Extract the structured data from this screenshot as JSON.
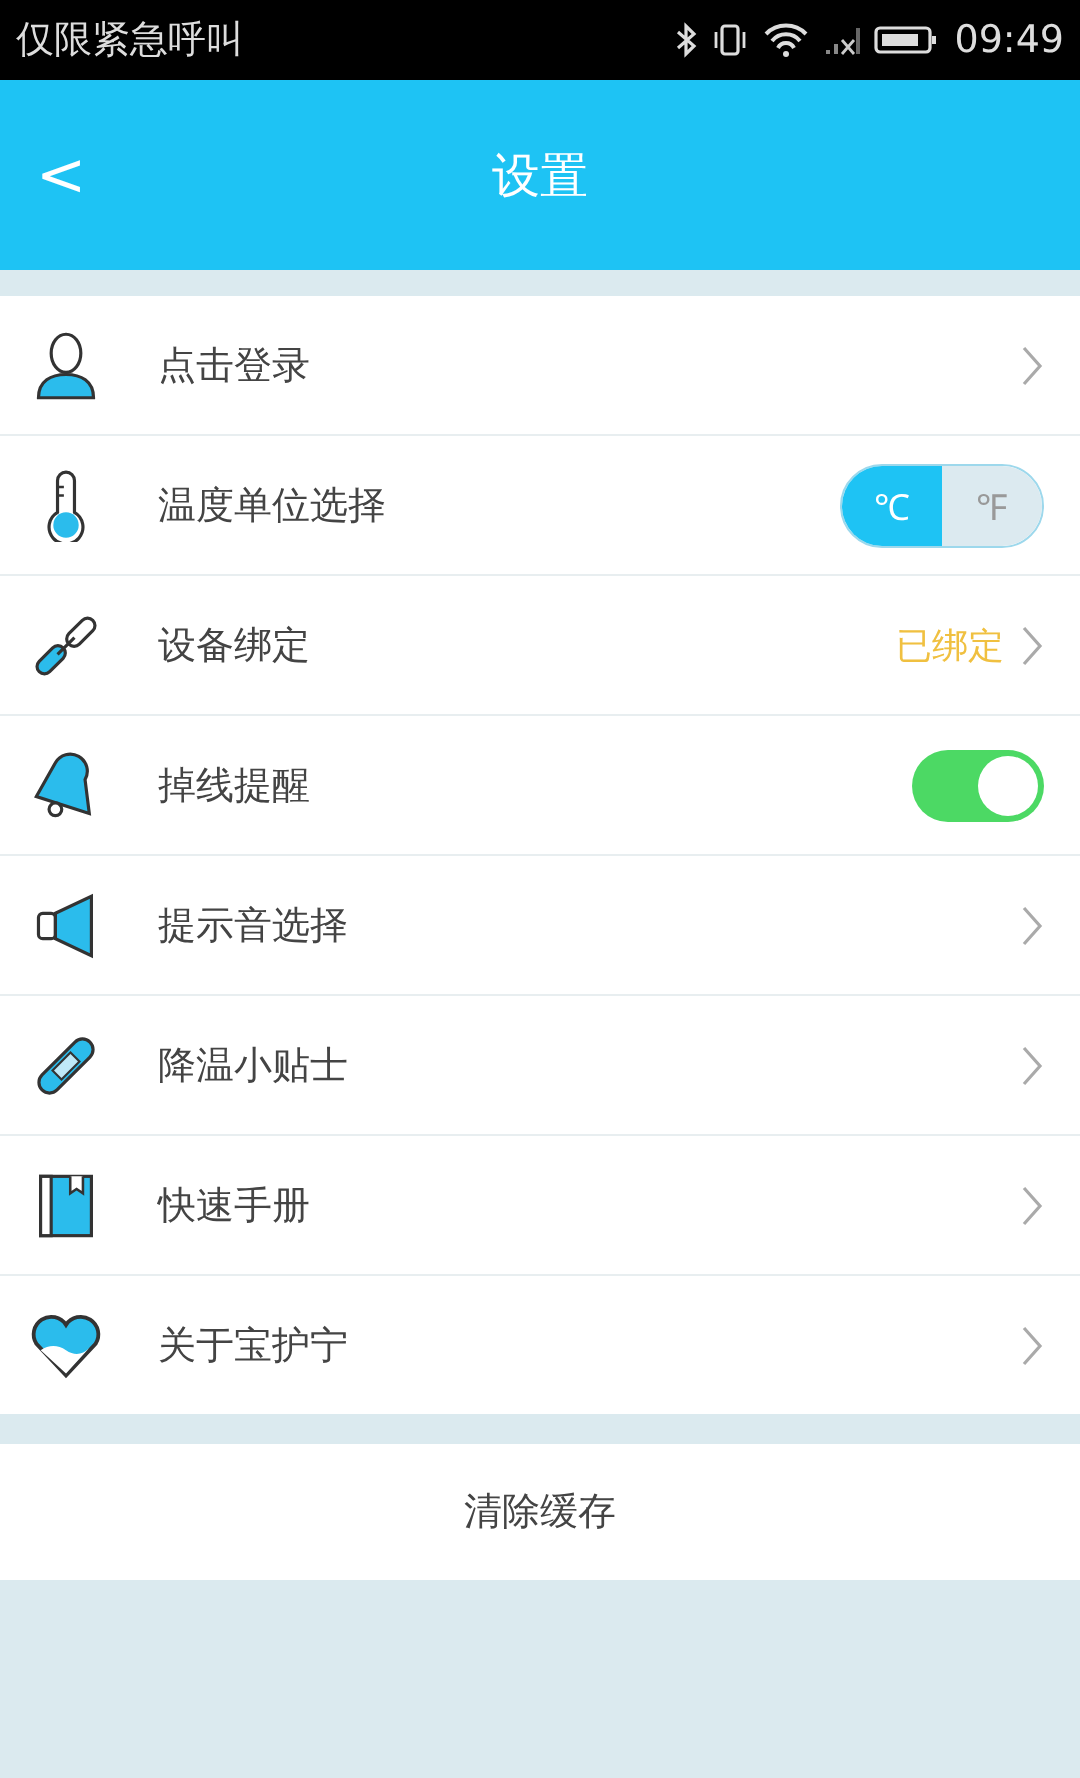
{
  "status_bar": {
    "carrier": "仅限紧急呼叫",
    "time": "09:49"
  },
  "header": {
    "back": "<",
    "title": "设置"
  },
  "items": [
    {
      "kind": "chevron",
      "label": "点击登录"
    },
    {
      "kind": "unit_toggle",
      "label": "温度单位选择",
      "options": [
        {
          "label": "℃",
          "selected": true
        },
        {
          "label": "℉",
          "selected": false
        }
      ]
    },
    {
      "kind": "value_chevron",
      "label": "设备绑定",
      "value": "已绑定"
    },
    {
      "kind": "switch",
      "label": "掉线提醒",
      "on": true
    },
    {
      "kind": "chevron",
      "label": "提示音选择"
    },
    {
      "kind": "chevron",
      "label": "降温小贴士"
    },
    {
      "kind": "chevron",
      "label": "快速手册"
    },
    {
      "kind": "chevron",
      "label": "关于宝护宁"
    }
  ],
  "clear_cache": "清除缓存"
}
